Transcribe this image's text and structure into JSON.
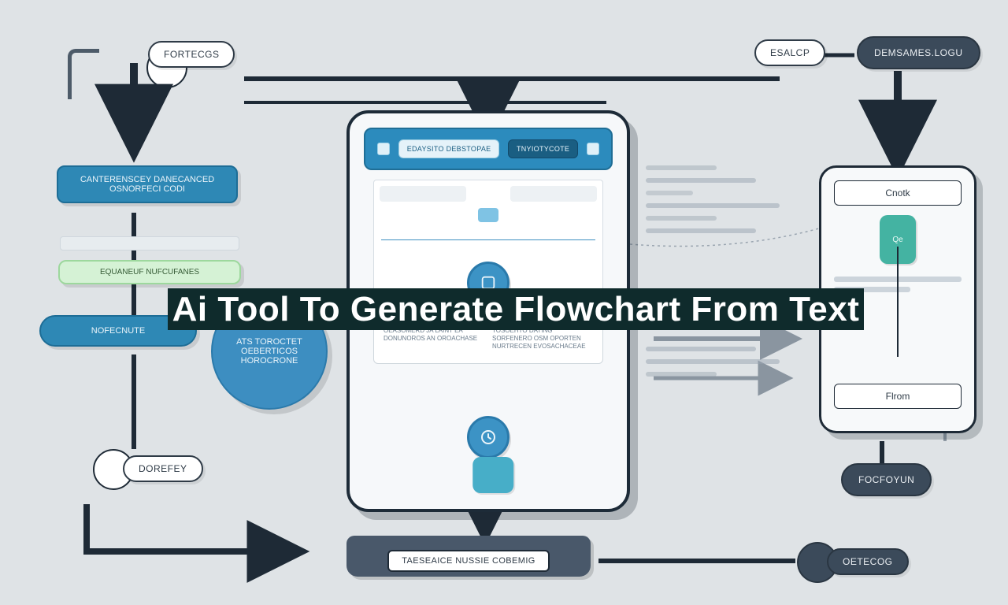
{
  "headline": "Ai Tool To Generate Flowchart From Text",
  "nodes": {
    "top_left_pill": "FORTECGS",
    "top_right_pill_a": "ESALCP",
    "top_right_pill_b": "DEMSAMES.LOGU",
    "left_teal_box": "CANTERENSCEY DANECANCED OSNORFECI CODI",
    "left_green_box": "EQUANEUF NUFCUFANES",
    "left_tag_box": "NOFECNUTE",
    "left_circle_label": "ATS TOROCTET OEBERTICOS HOROCRONE",
    "left_pill_bottom": "DOREFEY",
    "right_pill_bottom": "FOCFOYUN",
    "right_pill_lower": "OETECOG",
    "tray_label": "TAESEAICE NUSSIE COBEMIG"
  },
  "tablet": {
    "tab_a": "EDAYSITO DEBSTOPAE",
    "tab_b": "TNYIOTYCOTE",
    "detail_col_1": "CPONL DAN DERSCHING CENA OEASOMERD JA LAINT EA DONUNOROS AN OROACHASE",
    "detail_col_2": "CHANS THE DEINCORG TOSOEHTO DATING SORFENERO OSM OPORTEN NURTRECEN EVOSACHACEAE"
  },
  "panel": {
    "top_field": "Cnotk",
    "chip_label": "Qe",
    "bottom_field": "Flrom"
  }
}
